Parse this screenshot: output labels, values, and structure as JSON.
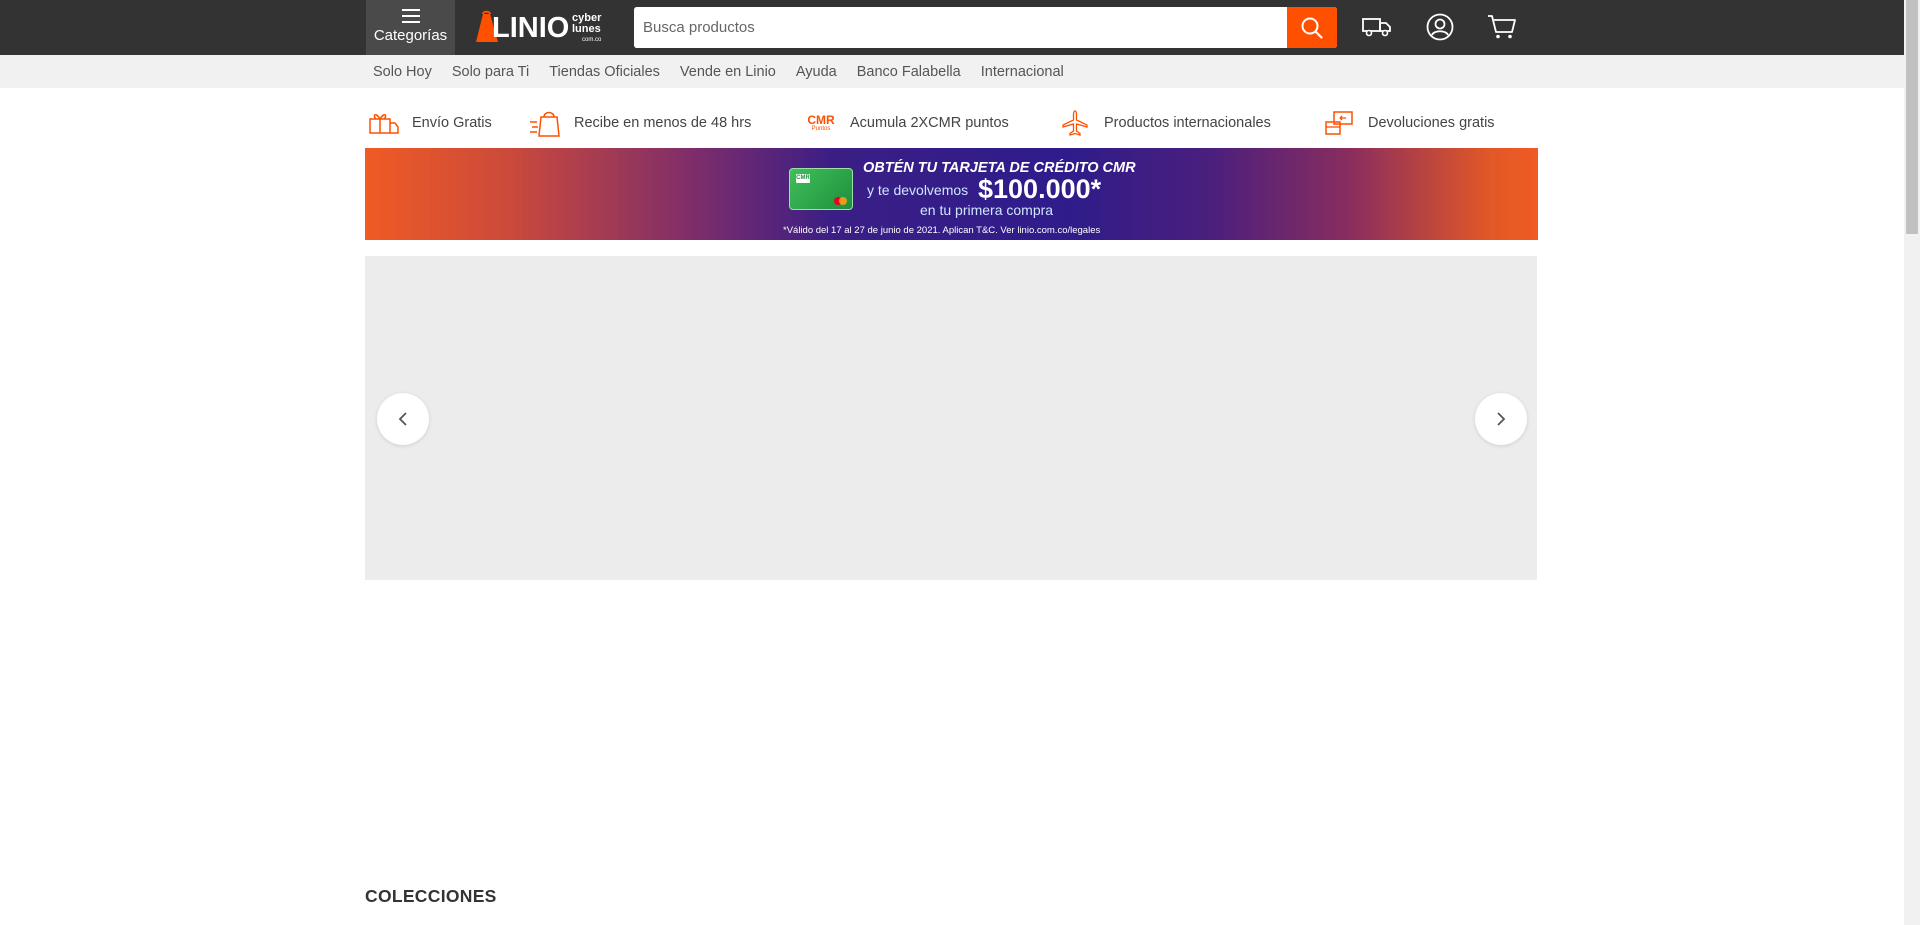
{
  "header": {
    "categories_label": "Categorías",
    "logo_text": "LINIO",
    "badge_line1": "cyber",
    "badge_line2": "lunes",
    "badge_line3": "com.co",
    "search_placeholder": "Busca productos",
    "search_value": ""
  },
  "icons": {
    "menu": "hamburger-menu-icon",
    "search": "magnifier-icon",
    "orders": "delivery-truck-icon",
    "account": "user-circle-icon",
    "cart": "shopping-cart-icon",
    "carousel_prev": "chevron-left-icon",
    "carousel_next": "chevron-right-icon"
  },
  "subnav": {
    "items": [
      {
        "label": "Solo Hoy"
      },
      {
        "label": "Solo para Ti"
      },
      {
        "label": "Tiendas Oficiales"
      },
      {
        "label": "Vende en Linio"
      },
      {
        "label": "Ayuda"
      },
      {
        "label": "Banco Falabella"
      },
      {
        "label": "Internacional"
      }
    ]
  },
  "benefits": [
    {
      "label": "Envío Gratis",
      "icon": "gift-truck-icon"
    },
    {
      "label": "Recibe en menos de 48 hrs",
      "icon": "fast-bag-icon"
    },
    {
      "label": "Acumula 2XCMR puntos",
      "icon": "cmr-points-icon",
      "icon_text": "CMR",
      "icon_subtext": "Puntos"
    },
    {
      "label": "Productos internacionales",
      "icon": "airplane-icon"
    },
    {
      "label": "Devoluciones gratis",
      "icon": "return-box-icon"
    }
  ],
  "promo": {
    "line1": "OBTÉN TU TARJETA DE CRÉDITO CMR",
    "line2": "y te devolvemos",
    "amount": "$100.000*",
    "line3": "en tu primera compra",
    "legal": "*Válido del 17 al 27 de junio de 2021. Aplican T&C. Ver linio.com.co/legales",
    "card_brand": "CMR"
  },
  "sections": {
    "collections_title": "COLECCIONES"
  },
  "colors": {
    "topbar": "#333333",
    "accent": "#ff5000",
    "subnav_bg": "#f1f1f1",
    "hero_bg": "#ececec"
  }
}
